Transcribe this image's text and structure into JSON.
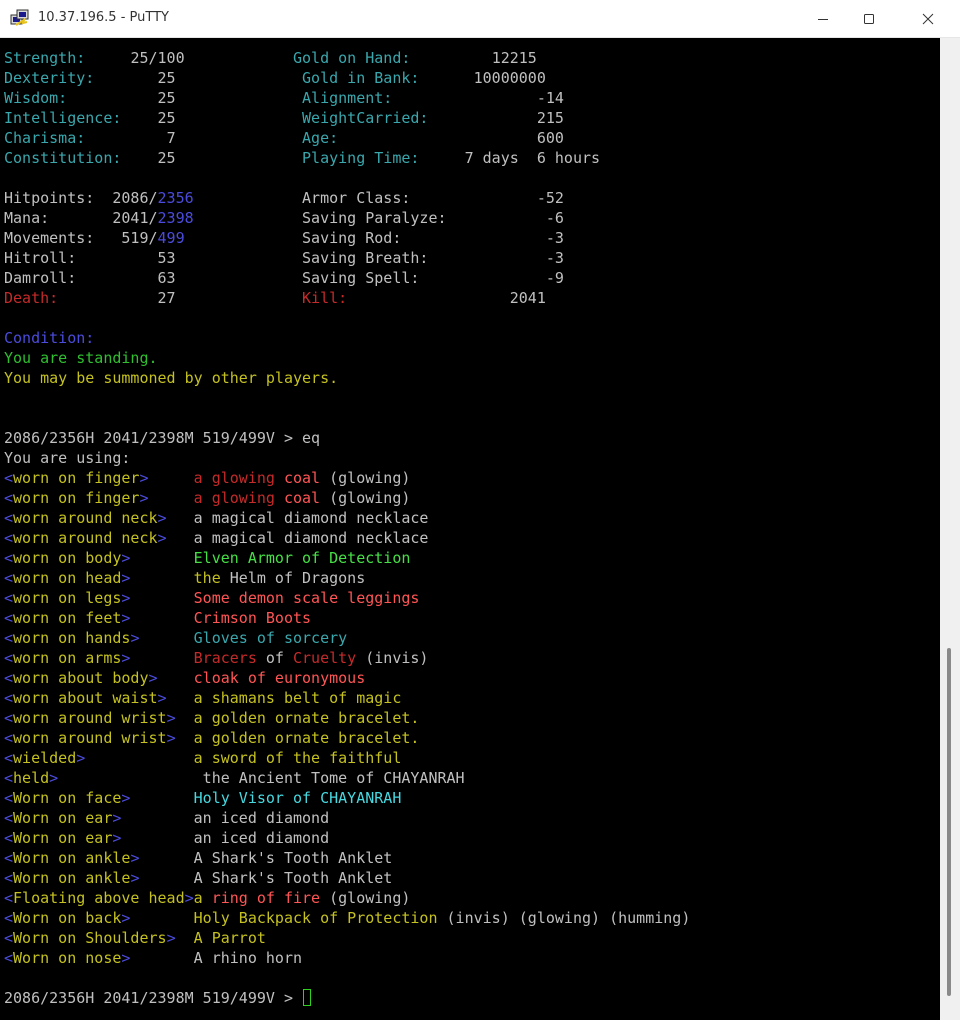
{
  "window": {
    "title": "10.37.196.5 - PuTTY"
  },
  "colors": {
    "white": "#c0c0c0",
    "cyan": "#3aa7ad",
    "yellow": "#c4c121",
    "red": "#c52a2a",
    "green": "#2fbf2f",
    "blue": "#4b4bdc",
    "brightgreen": "#45e045",
    "brightcyan": "#47d8e0",
    "brightwhite": "#ffffff",
    "brightred": "#ff5555",
    "brightyellow": "#f2f24c"
  },
  "terminal": {
    "lines": [
      [
        [
          "cyan",
          "Strength:     "
        ],
        [
          "white",
          "25/100"
        ],
        [
          "white",
          "            "
        ],
        [
          "cyan",
          "Gold on Hand:         "
        ],
        [
          "white",
          "12215"
        ]
      ],
      [
        [
          "cyan",
          "Dexterity:       "
        ],
        [
          "white",
          "25"
        ],
        [
          "white",
          "              "
        ],
        [
          "cyan",
          "Gold in Bank:      "
        ],
        [
          "white",
          "10000000"
        ]
      ],
      [
        [
          "cyan",
          "Wisdom:          "
        ],
        [
          "white",
          "25"
        ],
        [
          "white",
          "              "
        ],
        [
          "cyan",
          "Alignment:                "
        ],
        [
          "white",
          "-14"
        ]
      ],
      [
        [
          "cyan",
          "Intelligence:   "
        ],
        [
          "white",
          " 25"
        ],
        [
          "white",
          "              "
        ],
        [
          "cyan",
          "WeightCarried:            "
        ],
        [
          "white",
          "215"
        ]
      ],
      [
        [
          "cyan",
          "Charisma:         "
        ],
        [
          "white",
          "7"
        ],
        [
          "white",
          "              "
        ],
        [
          "cyan",
          "Age:                      "
        ],
        [
          "white",
          "600"
        ]
      ],
      [
        [
          "cyan",
          "Constitution:   "
        ],
        [
          "white",
          " 25"
        ],
        [
          "white",
          "              "
        ],
        [
          "cyan",
          "Playing Time:     "
        ],
        [
          "white",
          "7 days  6 hours"
        ]
      ],
      [],
      [
        [
          "white",
          "Hitpoints:  2086/"
        ],
        [
          "blue",
          "2356"
        ],
        [
          "white",
          "            "
        ],
        [
          "white",
          "Armor Class:              -52"
        ]
      ],
      [
        [
          "white",
          "Mana:       2041/"
        ],
        [
          "blue",
          "2398"
        ],
        [
          "white",
          "            "
        ],
        [
          "white",
          "Saving Paralyze:           -6"
        ]
      ],
      [
        [
          "white",
          "Movements:   519/"
        ],
        [
          "blue",
          "499"
        ],
        [
          "white",
          "             "
        ],
        [
          "white",
          "Saving Rod:                -3"
        ]
      ],
      [
        [
          "white",
          "Hitroll:         53"
        ],
        [
          "white",
          "              "
        ],
        [
          "white",
          "Saving Breath:             -3"
        ]
      ],
      [
        [
          "white",
          "Damroll:         63"
        ],
        [
          "white",
          "              "
        ],
        [
          "white",
          "Saving Spell:              -9"
        ]
      ],
      [
        [
          "red",
          "Death:"
        ],
        [
          "white",
          "           27"
        ],
        [
          "white",
          "              "
        ],
        [
          "red",
          "Kill:"
        ],
        [
          "white",
          "                  2041"
        ]
      ],
      [],
      [
        [
          "blue",
          "Condition:"
        ]
      ],
      [
        [
          "green",
          "You are standing."
        ]
      ],
      [
        [
          "yellow",
          "You may be summoned by other players."
        ]
      ],
      [],
      [],
      [
        [
          "white",
          "2086/2356H 2041/2398M 519/499V > eq"
        ]
      ],
      [
        [
          "white",
          "You are using:"
        ]
      ],
      [
        [
          "blue",
          "<"
        ],
        [
          "yellow",
          "worn on finger"
        ],
        [
          "blue",
          ">"
        ],
        [
          "white",
          "     "
        ],
        [
          "red",
          "a glowing "
        ],
        [
          "brightred",
          "coal"
        ],
        [
          "white",
          " (glowing)"
        ]
      ],
      [
        [
          "blue",
          "<"
        ],
        [
          "yellow",
          "worn on finger"
        ],
        [
          "blue",
          ">"
        ],
        [
          "white",
          "     "
        ],
        [
          "red",
          "a glowing "
        ],
        [
          "brightred",
          "coal"
        ],
        [
          "white",
          " (glowing)"
        ]
      ],
      [
        [
          "blue",
          "<"
        ],
        [
          "yellow",
          "worn around neck"
        ],
        [
          "blue",
          ">"
        ],
        [
          "white",
          "   a magical diamond necklace"
        ]
      ],
      [
        [
          "blue",
          "<"
        ],
        [
          "yellow",
          "worn around neck"
        ],
        [
          "blue",
          ">"
        ],
        [
          "white",
          "   a magical diamond necklace"
        ]
      ],
      [
        [
          "blue",
          "<"
        ],
        [
          "yellow",
          "worn on body"
        ],
        [
          "blue",
          ">"
        ],
        [
          "white",
          "       "
        ],
        [
          "brightgreen",
          "Elven Armor of Detection"
        ]
      ],
      [
        [
          "blue",
          "<"
        ],
        [
          "yellow",
          "worn on head"
        ],
        [
          "blue",
          ">"
        ],
        [
          "white",
          "       "
        ],
        [
          "yellow",
          "the"
        ],
        [
          "white",
          " Helm of Dragons"
        ]
      ],
      [
        [
          "blue",
          "<"
        ],
        [
          "yellow",
          "worn on legs"
        ],
        [
          "blue",
          ">"
        ],
        [
          "white",
          "       "
        ],
        [
          "brightred",
          "Some demon scale leggings"
        ]
      ],
      [
        [
          "blue",
          "<"
        ],
        [
          "yellow",
          "worn on feet"
        ],
        [
          "blue",
          ">"
        ],
        [
          "white",
          "       "
        ],
        [
          "brightred",
          "Crimson Boots"
        ]
      ],
      [
        [
          "blue",
          "<"
        ],
        [
          "yellow",
          "worn on hands"
        ],
        [
          "blue",
          ">"
        ],
        [
          "white",
          "      "
        ],
        [
          "cyan",
          "Gloves of sorcery"
        ]
      ],
      [
        [
          "blue",
          "<"
        ],
        [
          "yellow",
          "worn on arms"
        ],
        [
          "blue",
          ">"
        ],
        [
          "white",
          "       "
        ],
        [
          "red",
          "Bracers"
        ],
        [
          "white",
          " of "
        ],
        [
          "red",
          "Cruelty"
        ],
        [
          "white",
          " (invis)"
        ]
      ],
      [
        [
          "blue",
          "<"
        ],
        [
          "yellow",
          "worn about body"
        ],
        [
          "blue",
          ">"
        ],
        [
          "white",
          "    "
        ],
        [
          "brightred",
          "cloak of euronymous"
        ]
      ],
      [
        [
          "blue",
          "<"
        ],
        [
          "yellow",
          "worn about waist"
        ],
        [
          "blue",
          ">"
        ],
        [
          "white",
          "   "
        ],
        [
          "yellow",
          "a shamans belt of magic"
        ]
      ],
      [
        [
          "blue",
          "<"
        ],
        [
          "yellow",
          "worn around wrist"
        ],
        [
          "blue",
          ">"
        ],
        [
          "white",
          "  "
        ],
        [
          "yellow",
          "a golden ornate bracelet."
        ]
      ],
      [
        [
          "blue",
          "<"
        ],
        [
          "yellow",
          "worn around wrist"
        ],
        [
          "blue",
          ">"
        ],
        [
          "white",
          "  "
        ],
        [
          "yellow",
          "a golden ornate bracelet."
        ]
      ],
      [
        [
          "blue",
          "<"
        ],
        [
          "yellow",
          "wielded"
        ],
        [
          "blue",
          ">"
        ],
        [
          "white",
          "            "
        ],
        [
          "yellow",
          "a sword of the faithful"
        ]
      ],
      [
        [
          "blue",
          "<"
        ],
        [
          "yellow",
          "held"
        ],
        [
          "blue",
          ">"
        ],
        [
          "white",
          "                the Ancient Tome of CHAYANRAH"
        ]
      ],
      [
        [
          "blue",
          "<"
        ],
        [
          "yellow",
          "Worn on face"
        ],
        [
          "blue",
          ">"
        ],
        [
          "white",
          "       "
        ],
        [
          "brightcyan",
          "Holy Visor of CHAYANRAH"
        ]
      ],
      [
        [
          "blue",
          "<"
        ],
        [
          "yellow",
          "Worn on ear"
        ],
        [
          "blue",
          ">"
        ],
        [
          "white",
          "        an iced diamond"
        ]
      ],
      [
        [
          "blue",
          "<"
        ],
        [
          "yellow",
          "Worn on ear"
        ],
        [
          "blue",
          ">"
        ],
        [
          "white",
          "        an iced diamond"
        ]
      ],
      [
        [
          "blue",
          "<"
        ],
        [
          "yellow",
          "Worn on ankle"
        ],
        [
          "blue",
          ">"
        ],
        [
          "white",
          "      A Shark's Tooth Anklet"
        ]
      ],
      [
        [
          "blue",
          "<"
        ],
        [
          "yellow",
          "Worn on ankle"
        ],
        [
          "blue",
          ">"
        ],
        [
          "white",
          "      A Shark's Tooth Anklet"
        ]
      ],
      [
        [
          "blue",
          "<"
        ],
        [
          "yellow",
          "Floating above head"
        ],
        [
          "blue",
          ">"
        ],
        [
          "yellow",
          "a "
        ],
        [
          "brightred",
          "ring of fire"
        ],
        [
          "white",
          " (glowing)"
        ]
      ],
      [
        [
          "blue",
          "<"
        ],
        [
          "yellow",
          "Worn on back"
        ],
        [
          "blue",
          ">"
        ],
        [
          "white",
          "       "
        ],
        [
          "yellow",
          "Holy Backpack of Protection"
        ],
        [
          "white",
          " (invis) (glowing) (humming)"
        ]
      ],
      [
        [
          "blue",
          "<"
        ],
        [
          "yellow",
          "Worn on Shoulders"
        ],
        [
          "blue",
          ">"
        ],
        [
          "white",
          "  "
        ],
        [
          "yellow",
          "A Parrot"
        ]
      ],
      [
        [
          "blue",
          "<"
        ],
        [
          "yellow",
          "Worn on nose"
        ],
        [
          "blue",
          ">"
        ],
        [
          "white",
          "       A rhino horn"
        ]
      ],
      [],
      [
        [
          "white",
          "2086/2356H 2041/2398M 519/499V > "
        ]
      ]
    ]
  }
}
